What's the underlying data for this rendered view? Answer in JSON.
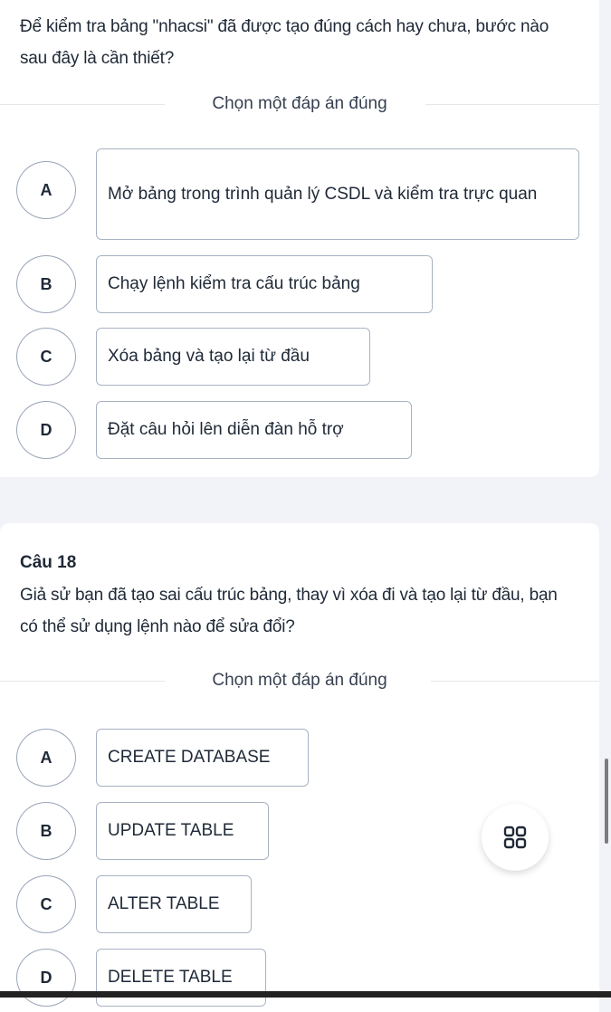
{
  "questions": [
    {
      "title": "",
      "text": "Để kiểm tra bảng \"nhacsi\" đã được tạo đúng cách hay chưa, bước nào sau đây là cần thiết?",
      "instruction": "Chọn một đáp án đúng",
      "options": [
        {
          "letter": "A",
          "text": "Mở bảng trong trình quản lý CSDL và kiểm tra trực quan"
        },
        {
          "letter": "B",
          "text": "Chạy lệnh kiểm tra cấu trúc bảng"
        },
        {
          "letter": "C",
          "text": "Xóa bảng và tạo lại từ đầu"
        },
        {
          "letter": "D",
          "text": "Đặt câu hỏi lên diễn đàn hỗ trợ"
        }
      ]
    },
    {
      "title": "Câu 18",
      "text": "Giả sử bạn đã tạo sai cấu trúc bảng, thay vì xóa đi và tạo lại từ đầu, bạn có thể sử dụng lệnh nào để sửa đổi?",
      "instruction": "Chọn một đáp án đúng",
      "options": [
        {
          "letter": "A",
          "text": "CREATE DATABASE"
        },
        {
          "letter": "B",
          "text": "UPDATE TABLE"
        },
        {
          "letter": "C",
          "text": "ALTER TABLE"
        },
        {
          "letter": "D",
          "text": "DELETE TABLE"
        }
      ]
    }
  ],
  "fab": {
    "icon": "grid-icon"
  }
}
